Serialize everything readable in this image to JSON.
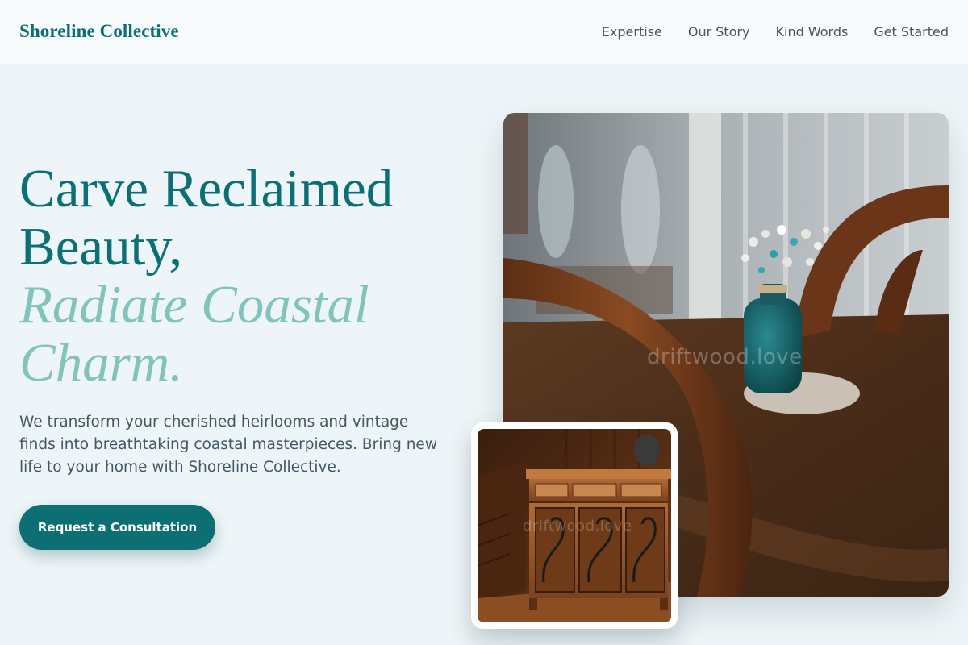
{
  "brand": "Shoreline Collective",
  "nav": [
    "Expertise",
    "Our Story",
    "Kind Words",
    "Get Started"
  ],
  "hero": {
    "title_line1": "Carve Reclaimed Beauty,",
    "title_accent": "Radiate Coastal Charm.",
    "description": "We transform your cherished heirlooms and vintage finds into breathtaking coastal masterpieces. Bring new life to your home with Shoreline Collective.",
    "cta_label": "Request a Consultation"
  },
  "images": {
    "main_watermark": "driftwood.love",
    "small_watermark": "driftwood.love"
  },
  "colors": {
    "brand_teal": "#0c6f74",
    "accent_seafoam": "#82c3bb",
    "background": "#eef5f8"
  }
}
